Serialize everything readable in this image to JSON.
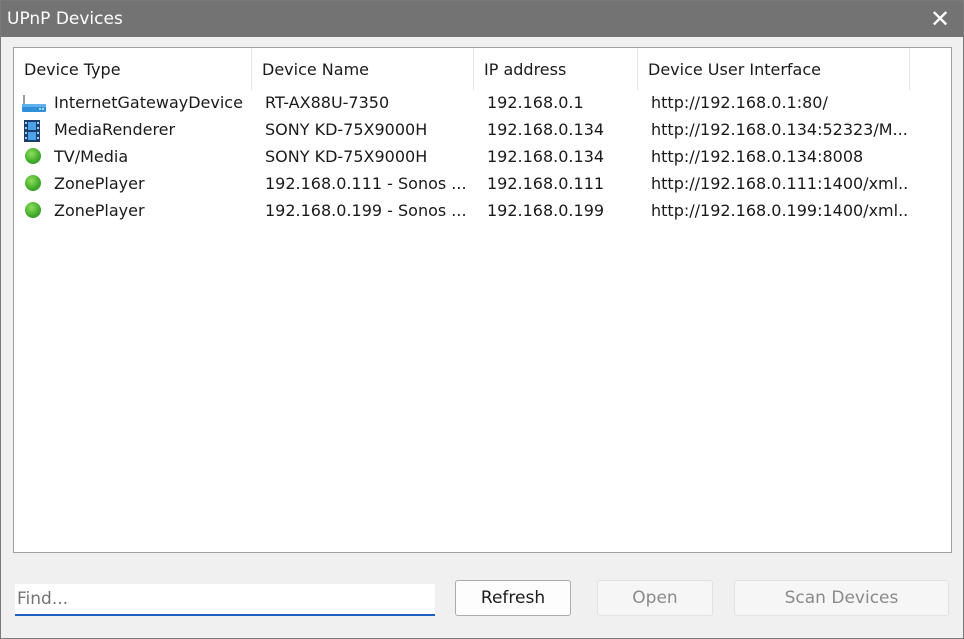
{
  "window": {
    "title": "UPnP Devices",
    "close_glyph": "✕"
  },
  "table": {
    "columns": [
      "Device Type",
      "Device Name",
      "IP address",
      "Device User Interface"
    ],
    "rows": [
      {
        "icon": "network-router-icon",
        "type": "InternetGatewayDevice",
        "name": "RT-AX88U-7350",
        "ip": "192.168.0.1",
        "ui": "http://192.168.0.1:80/"
      },
      {
        "icon": "film-strip-icon",
        "type": "MediaRenderer",
        "name": "SONY KD-75X9000H",
        "ip": "192.168.0.134",
        "ui": "http://192.168.0.134:52323/M..."
      },
      {
        "icon": "green-dot-icon",
        "type": "TV/Media",
        "name": "SONY KD-75X9000H",
        "ip": "192.168.0.134",
        "ui": "http://192.168.0.134:8008"
      },
      {
        "icon": "green-dot-icon",
        "type": "ZonePlayer",
        "name": "192.168.0.111 - Sonos ...",
        "ip": "192.168.0.111",
        "ui": "http://192.168.0.111:1400/xml..."
      },
      {
        "icon": "green-dot-icon",
        "type": "ZonePlayer",
        "name": "192.168.0.199 - Sonos ...",
        "ip": "192.168.0.199",
        "ui": "http://192.168.0.199:1400/xml..."
      }
    ]
  },
  "find": {
    "placeholder": "Find..."
  },
  "buttons": {
    "refresh": "Refresh",
    "open": "Open",
    "scan": "Scan Devices"
  },
  "colors": {
    "titlebar": "#737373",
    "focus_underline": "#1f5fbf",
    "status_green": "#3fa82a"
  }
}
